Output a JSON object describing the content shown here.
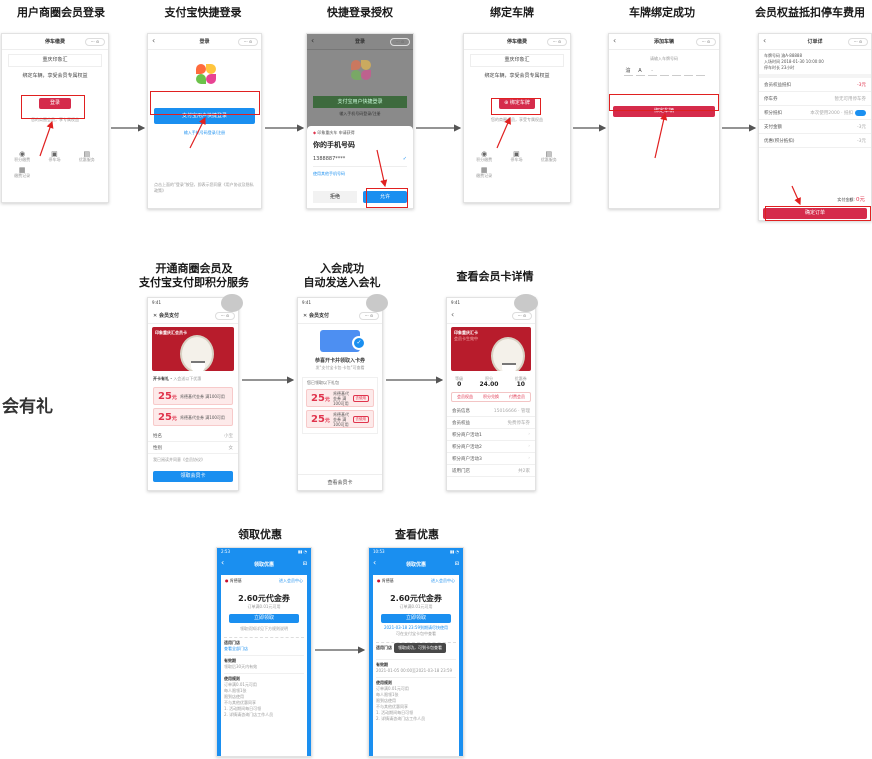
{
  "section_label": "会有礼",
  "colors": {
    "alipay_blue": "#1a8ff0",
    "accent_red": "#d52b4b",
    "highlight_red": "#e02020",
    "arrow": "#555555"
  },
  "titles": {
    "s1": "用户商圈会员登录",
    "s2": "支付宝快捷登录",
    "s3": "快捷登录授权",
    "s4": "绑定车牌",
    "s5": "车牌绑定成功",
    "s6": "会员权益抵扣停车费用",
    "s7_l1": "开通商圈会员及",
    "s7_l2": "支付宝支付即积分服务",
    "s8_l1": "入会成功",
    "s8_l2": "自动发送入会礼",
    "s9": "查看会员卡详情",
    "s10": "领取优惠",
    "s11": "查看优惠"
  },
  "p1": {
    "title": "停车缴费",
    "location": "重庆印象汇",
    "prompt": "绑定车辆，享受会员专属权益",
    "login": "登录",
    "hint": "您的商圈会员，享专属权益",
    "grid": [
      "积分缴费",
      "停车场",
      "优惠服务",
      "缴费记录"
    ]
  },
  "p2": {
    "title": "登录",
    "alipay_login": "支付宝用户快捷登录",
    "phone_login": "输入手机号码登录/注册",
    "agree": "点击上面的\"登录\"按钮，即表示您同意《用户协议及隐私政策》"
  },
  "p3": {
    "title": "登录",
    "bg_btn": "支付宝用户快捷登录",
    "bg_link": "输入手机号码登录/注册",
    "app": "印象重庆车 申请获得",
    "heading": "你的手机号码",
    "phone": "1388887****",
    "other": "使用其他手机号码",
    "reject": "拒绝",
    "allow": "允许"
  },
  "p4": {
    "title": "停车缴费",
    "location": "重庆印象汇",
    "prompt": "绑定车辆，享受会员专属权益",
    "bind": "绑定车牌",
    "hint": "您的商圈会员，享受专属权益",
    "grid": [
      "积分缴费",
      "停车场",
      "优惠服务",
      "缴费记录"
    ]
  },
  "p5": {
    "title": "添加车辆",
    "hint": "请输入车牌号码",
    "plate": [
      "渝",
      "A",
      "·",
      "",
      "",
      "",
      "",
      ""
    ],
    "bind": "绑定车辆"
  },
  "p6": {
    "title": "订单详",
    "info": [
      [
        "车牌号码",
        "渝A·88888"
      ],
      [
        "入场时间",
        "2018-01-30 10:00:00"
      ],
      [
        "停车时长",
        "23小时"
      ]
    ],
    "rows": [
      [
        "会员权益抵扣",
        "-3元"
      ],
      [
        "停车券",
        "暂无可用停车券"
      ],
      [
        "积分抵扣",
        "本次使用2000 · 抵扣"
      ],
      [
        "支付金额",
        "-3元"
      ],
      [
        "优惠(积分抵扣)",
        "-3元"
      ]
    ],
    "pay_label": "实付金额:",
    "pay_value": "0元",
    "confirm": "确定订单"
  },
  "p7": {
    "title": "会员支付",
    "mall": "印象重庆汇会员卡",
    "perks_title": "开卡有礼",
    "perks_sub": "入会送以下优惠",
    "coupons": [
      {
        "val": "25",
        "unit": "元",
        "desc": "肯德基代金券 满100可用"
      },
      {
        "val": "25",
        "unit": "元",
        "desc": "肯德基代金券 满100可用"
      }
    ],
    "form": [
      [
        "姓名",
        "小宝"
      ],
      [
        "性别",
        "女"
      ]
    ],
    "agree": "我已阅读并同意《会员协议》",
    "submit": "领取会员卡"
  },
  "p8": {
    "title": "会员支付",
    "welcome": "恭喜开卡并领取入卡券",
    "sub": "发\"支付宝卡包·卡包\"可查看",
    "gift_title": "您已领取以下礼包",
    "coupons": [
      {
        "val": "25",
        "unit": "元",
        "desc": "肯德基代金券 满100可用",
        "btn": "去使用"
      },
      {
        "val": "25",
        "unit": "元",
        "desc": "肯德基代金券 满100可用",
        "btn": "去使用"
      }
    ],
    "view": "查看会员卡"
  },
  "p9": {
    "mall": "印象重庆汇卡",
    "sub": "会员卡生效中",
    "stats": [
      [
        "等级",
        "0"
      ],
      [
        "积分",
        "24.00"
      ],
      [
        "优惠券",
        "10"
      ]
    ],
    "actions": [
      "会员权益",
      "积分兑换",
      "付费会员"
    ],
    "rows": [
      [
        "会员信息",
        "15016666 · 管理"
      ],
      [
        "会员权益",
        "免费停车券"
      ],
      [
        "积分商户活动1",
        ""
      ],
      [
        "积分商户活动2",
        ""
      ],
      [
        "积分商户活动3",
        ""
      ],
      [
        "适用门店",
        "共2家"
      ]
    ]
  },
  "p10": {
    "title": "领取优惠",
    "brand": "肯德基",
    "more": "进入会员中心",
    "amount": "2.60元代金券",
    "cond": "订单满0.01元可用",
    "btn": "立即领取",
    "notice": "领取须知详见下方规则说明",
    "stores_label": "适用门店",
    "stores_link": "查看全部门店",
    "period_label": "有效期",
    "period": "领取后30天内有效",
    "rules_label": "使用规则",
    "rules": [
      "订单满0.01元可用",
      "每人限领1张",
      "限到店使用",
      "不与其他优惠同享",
      "1. 活动期间每日可领",
      "2. 详情请咨询门店工作人员"
    ]
  },
  "p11": {
    "title": "领取优惠",
    "brand": "肯德基",
    "more": "进入会员中心",
    "amount": "2.60元代金券",
    "cond": "订单满0.01元可用",
    "btn": "立即领取",
    "got": "2021-03-18 23:59到期请尽快使用",
    "got_sub": "可在支付宝卡包中查看",
    "toast": "领取成功，可到卡包查看",
    "stores_label": "适用门店",
    "period_label": "有效期",
    "period": "2021-01-05 00:00至2021-03-18 23:59",
    "rules_label": "使用规则",
    "rules": [
      "订单满0.01元可用",
      "每人限领1张",
      "限到店使用",
      "不与其他优惠同享",
      "1. 活动期间每日可领",
      "2. 详情请咨询门店工作人员"
    ]
  }
}
